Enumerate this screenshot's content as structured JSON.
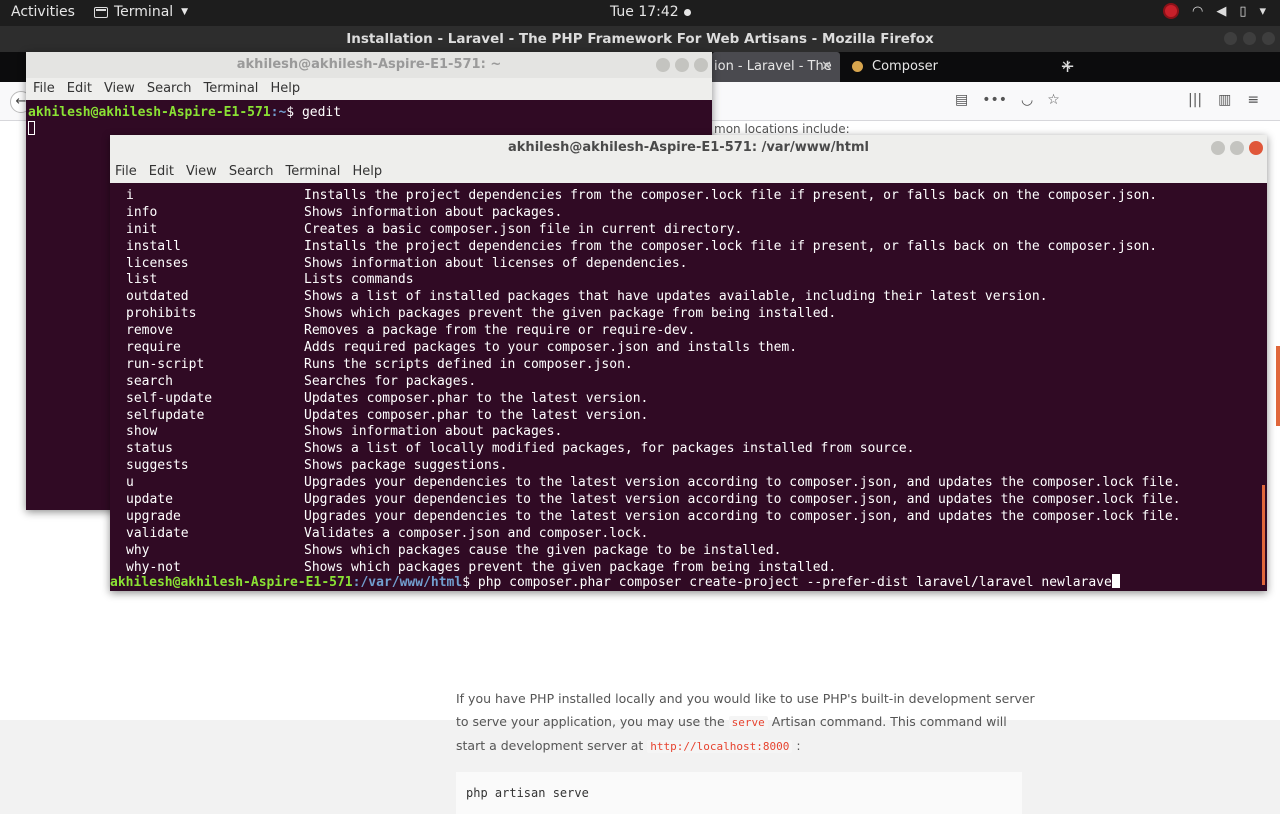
{
  "topbar": {
    "activities": "Activities",
    "app_name": "Terminal",
    "clock": "Tue 17:42"
  },
  "firefox": {
    "window_title": "Installation - Laravel - The PHP Framework For Web Artisans - Mozilla Firefox",
    "tabs": [
      {
        "label": "ion - Laravel - The"
      },
      {
        "label": "Composer"
      }
    ],
    "content": {
      "partial_heading": "mon locations include:",
      "paragraph_1": "If you have PHP installed locally and you would like to use PHP's built-in development server to serve your application, you may use the",
      "serve_code": "serve",
      "paragraph_2": "Artisan command. This command will start a development server at",
      "localhost_code": "http://localhost:8000",
      "paragraph_3": ":",
      "code_block": "php artisan serve"
    }
  },
  "terminal_back": {
    "title": "akhilesh@akhilesh-Aspire-E1-571: ~",
    "menu": [
      "File",
      "Edit",
      "View",
      "Search",
      "Terminal",
      "Help"
    ],
    "prompt_user": "akhilesh@akhilesh-Aspire-E1-571",
    "prompt_path": ":~",
    "prompt_suffix": "$ ",
    "command": "gedit"
  },
  "terminal_front": {
    "title": "akhilesh@akhilesh-Aspire-E1-571: /var/www/html",
    "menu": [
      "File",
      "Edit",
      "View",
      "Search",
      "Terminal",
      "Help"
    ],
    "commands": [
      {
        "name": "i",
        "desc": "Installs the project dependencies from the composer.lock file if present, or falls back on the composer.json."
      },
      {
        "name": "info",
        "desc": "Shows information about packages."
      },
      {
        "name": "init",
        "desc": "Creates a basic composer.json file in current directory."
      },
      {
        "name": "install",
        "desc": "Installs the project dependencies from the composer.lock file if present, or falls back on the composer.json."
      },
      {
        "name": "licenses",
        "desc": "Shows information about licenses of dependencies."
      },
      {
        "name": "list",
        "desc": "Lists commands"
      },
      {
        "name": "outdated",
        "desc": "Shows a list of installed packages that have updates available, including their latest version."
      },
      {
        "name": "prohibits",
        "desc": "Shows which packages prevent the given package from being installed."
      },
      {
        "name": "remove",
        "desc": "Removes a package from the require or require-dev."
      },
      {
        "name": "require",
        "desc": "Adds required packages to your composer.json and installs them."
      },
      {
        "name": "run-script",
        "desc": "Runs the scripts defined in composer.json."
      },
      {
        "name": "search",
        "desc": "Searches for packages."
      },
      {
        "name": "self-update",
        "desc": "Updates composer.phar to the latest version."
      },
      {
        "name": "selfupdate",
        "desc": "Updates composer.phar to the latest version."
      },
      {
        "name": "show",
        "desc": "Shows information about packages."
      },
      {
        "name": "status",
        "desc": "Shows a list of locally modified packages, for packages installed from source."
      },
      {
        "name": "suggests",
        "desc": "Shows package suggestions."
      },
      {
        "name": "u",
        "desc": "Upgrades your dependencies to the latest version according to composer.json, and updates the composer.lock file."
      },
      {
        "name": "update",
        "desc": "Upgrades your dependencies to the latest version according to composer.json, and updates the composer.lock file."
      },
      {
        "name": "upgrade",
        "desc": "Upgrades your dependencies to the latest version according to composer.json, and updates the composer.lock file."
      },
      {
        "name": "validate",
        "desc": "Validates a composer.json and composer.lock."
      },
      {
        "name": "why",
        "desc": "Shows which packages cause the given package to be installed."
      },
      {
        "name": "why-not",
        "desc": "Shows which packages prevent the given package from being installed."
      }
    ],
    "prompt_user": "akhilesh@akhilesh-Aspire-E1-571",
    "prompt_path": ":/var/www/html",
    "prompt_suffix": "$ ",
    "current_input": "php composer.phar composer create-project --prefer-dist laravel/laravel newlarave"
  },
  "colors": {
    "terminal_bg": "#300a24",
    "prompt_user": "#8ae234",
    "prompt_path": "#729fcf",
    "accent": "#e0673b"
  }
}
